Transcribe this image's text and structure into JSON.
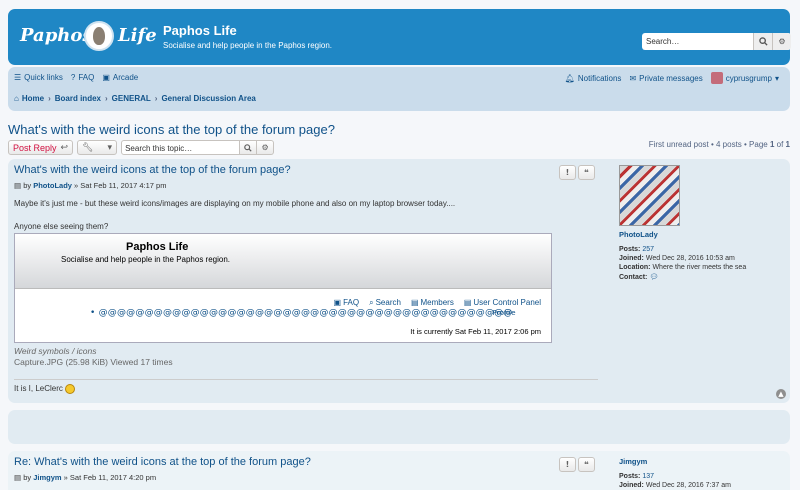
{
  "header": {
    "logo_text_left": "Paphos",
    "logo_text_right": "Life",
    "site_title": "Paphos Life",
    "site_description": "Socialise and help people in the Paphos region.",
    "search_placeholder": "Search…"
  },
  "nav": {
    "quick_links": "Quick links",
    "faq": "FAQ",
    "arcade": "Arcade",
    "notifications": "Notifications",
    "private_messages": "Private messages",
    "username": "cyprusgrump",
    "breadcrumbs": [
      "Home",
      "Board index",
      "GENERAL",
      "General Discussion Area"
    ]
  },
  "topic": {
    "title": "What's with the weird icons at the top of the forum page?",
    "post_reply": "Post Reply",
    "search_placeholder": "Search this topic…",
    "pagination": "First unread post • 4 posts • Page",
    "page_current": "1",
    "page_of": "of",
    "page_total": "1"
  },
  "posts": [
    {
      "title": "What's with the weird icons at the top of the forum page?",
      "by": "by",
      "author": "PhotoLady",
      "date": "» Sat Feb 11, 2017 4:17 pm",
      "body_line1": "Maybe it's just me - but these weird icons/images are displaying on my mobile phone and also on my laptop browser today....",
      "body_line2": "Anyone else seeing them?",
      "attachment": {
        "title": "Paphos Life",
        "description": "Socialise and help people in the Paphos region.",
        "links": [
          "FAQ",
          "Search",
          "Members",
          "User Control Panel"
        ],
        "glyphs": "• @@@@@@@@@@@@@@@@@@@@@@@@@@@@@@@@@@@@@@@@@@@@@",
        "glyph_end": "Profile",
        "time": "It is currently Sat Feb 11, 2017 2:06 pm",
        "caption": "Weird symbols / icons",
        "file": "Capture.JPG (25.98 KiB) Viewed 17 times"
      },
      "signature": "It is I, LeClerc",
      "profile": {
        "name": "PhotoLady",
        "posts_label": "Posts:",
        "posts": "257",
        "joined_label": "Joined:",
        "joined": "Wed Dec 28, 2016 10:53 am",
        "location_label": "Location:",
        "location": "Where the river meets the sea",
        "contact_label": "Contact:"
      }
    },
    {
      "title": "Re: What's with the weird icons at the top of the forum page?",
      "by": "by",
      "author": "Jimgym",
      "date": "» Sat Feb 11, 2017 4:20 pm",
      "profile": {
        "name": "Jimgym",
        "posts_label": "Posts:",
        "posts": "137",
        "joined_label": "Joined:",
        "joined": "Wed Dec 28, 2016 7:37 am"
      }
    }
  ],
  "colors": {
    "header_blue": "#1f87c5",
    "nav_bg": "#cadceb",
    "post_bg": "#e1ebf2",
    "link": "#105289",
    "post_reply_red": "#d31141"
  }
}
